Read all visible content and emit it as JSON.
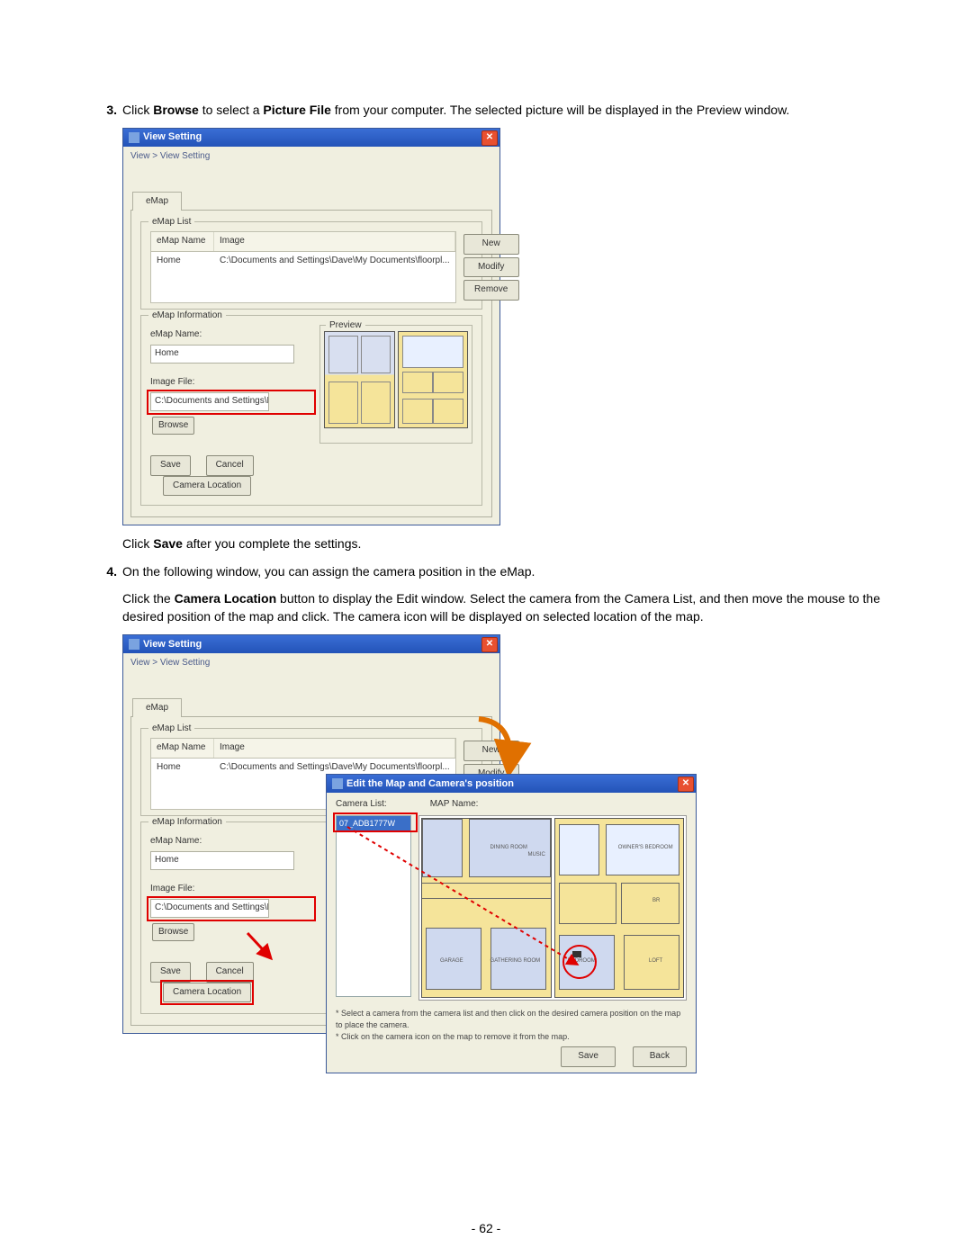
{
  "steps": {
    "s3": {
      "num": "3.",
      "pre": "Click ",
      "b1": "Browse",
      "mid1": " to select a ",
      "b2": "Picture File",
      "post": " from your computer. The selected picture will be displayed in the Preview window."
    },
    "s3b": {
      "pre": "Click ",
      "b1": "Save",
      "post": " after you complete the settings."
    },
    "s4": {
      "num": "4.",
      "line1": "On the following window, you can assign the camera position in the eMap.",
      "l2_pre": "Click the ",
      "l2_b": "Camera Location",
      "l2_post": " button to display the Edit window. Select the camera from the Camera List, and then move the mouse to the desired position of the map and click. The camera icon will be displayed on selected location of the map."
    }
  },
  "win": {
    "title": "View Setting",
    "breadcrumb": "View > View Setting",
    "tab": "eMap",
    "grp_list": "eMap List",
    "grp_info": "eMap Information",
    "col_name": "eMap Name",
    "col_image": "Image",
    "row_name": "Home",
    "row_image": "C:\\Documents and Settings\\Dave\\My Documents\\floorpl...",
    "btn_new": "New",
    "btn_modify": "Modify",
    "btn_remove": "Remove",
    "lbl_name": "eMap Name:",
    "val_name": "Home",
    "lbl_imgfile": "Image File:",
    "val_imgfile": "C:\\Documents and Settings\\Dave\\My Docum",
    "btn_browse": "Browse",
    "preview": "Preview",
    "btn_save": "Save",
    "btn_cancel": "Cancel",
    "btn_camloc": "Camera Location"
  },
  "win2": {
    "camloc": "Camera Location"
  },
  "edit": {
    "title": "Edit the Map and Camera's position",
    "camlist": "Camera List:",
    "mapname": "MAP Name:",
    "camitem": "07_ADB1777W",
    "tip1": "* Select a camera from the camera list and then click on the desired camera position on the map to place the camera.",
    "tip2": "* Click on the camera icon on the map to remove it from the map.",
    "btn_save": "Save",
    "btn_back": "Back"
  },
  "rooms": {
    "dining": "DINING ROOM",
    "music": "MUSIC",
    "garage": "GARAGE",
    "gather": "GATHERING ROOM",
    "owners": "OWNER'S BEDROOM",
    "bedroom": "BEDROOM",
    "loft": "LOFT",
    "br": "BR"
  },
  "pagenum": "- 62 -"
}
